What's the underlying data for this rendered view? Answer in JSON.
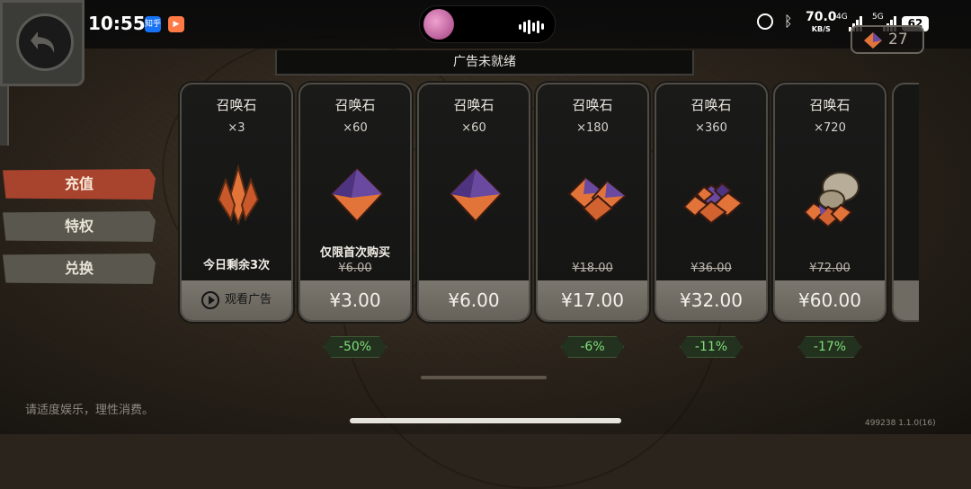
{
  "status_bar": {
    "time": "10:55",
    "app_icons": [
      "知乎",
      "tv"
    ],
    "network_speed": "70.0",
    "network_speed_unit": "KB/S",
    "network_4g": "4G",
    "network_5g": "5G",
    "battery": "62"
  },
  "currency": {
    "icon": "summon-stone-icon",
    "value": "27"
  },
  "ad_banner": "广告未就绪",
  "side_tabs": [
    {
      "label": "充值",
      "active": true
    },
    {
      "label": "特权",
      "active": false
    },
    {
      "label": "兑换",
      "active": false
    }
  ],
  "cards": [
    {
      "title": "召唤石",
      "qty": "×3",
      "note": "今日剩余3次",
      "old_price": "",
      "price": "观看广告",
      "discount": ""
    },
    {
      "title": "召唤石",
      "qty": "×60",
      "note": "仅限首次购买",
      "old_price": "¥6.00",
      "price": "¥3.00",
      "discount": "-50%"
    },
    {
      "title": "召唤石",
      "qty": "×60",
      "note": "",
      "old_price": "",
      "price": "¥6.00",
      "discount": ""
    },
    {
      "title": "召唤石",
      "qty": "×180",
      "note": "",
      "old_price": "¥18.00",
      "price": "¥17.00",
      "discount": "-6%"
    },
    {
      "title": "召唤石",
      "qty": "×360",
      "note": "",
      "old_price": "¥36.00",
      "price": "¥32.00",
      "discount": "-11%"
    },
    {
      "title": "召唤石",
      "qty": "×720",
      "note": "",
      "old_price": "¥72.00",
      "price": "¥60.00",
      "discount": "-17%"
    }
  ],
  "footer_note": "请适度娱乐，理性消费。",
  "version": "499238 1.1.0(16)",
  "colors": {
    "accent_tab": "#a8432e",
    "discount_text": "#7fe07a",
    "gem_orange": "#e2743a",
    "gem_purple": "#6a4aa0"
  }
}
